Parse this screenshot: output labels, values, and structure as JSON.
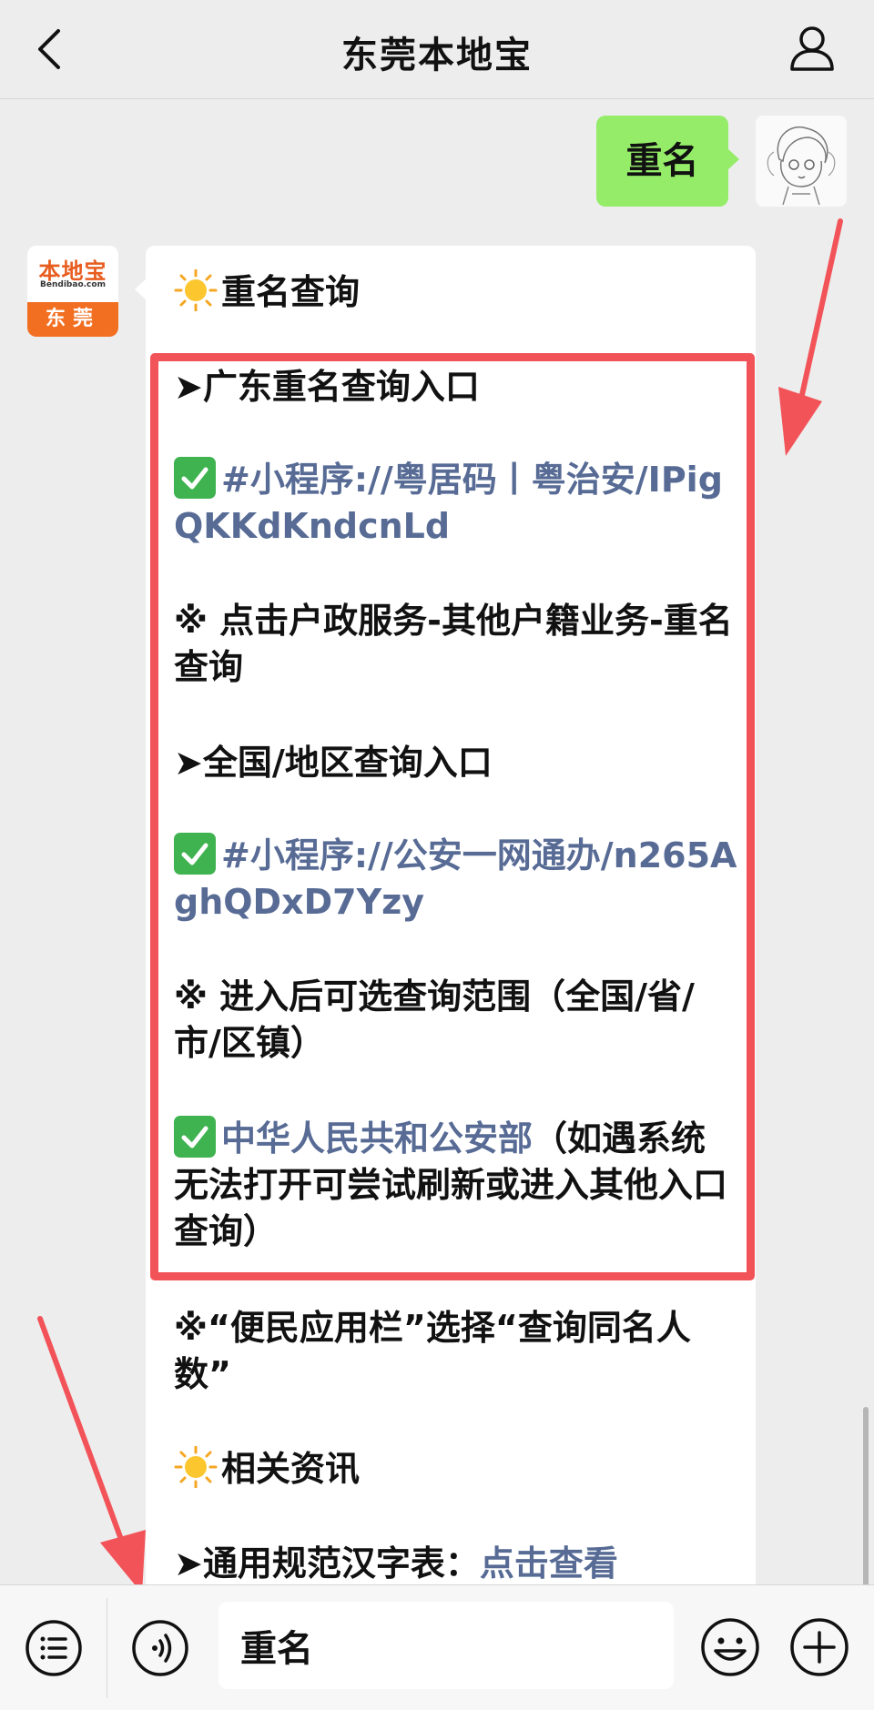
{
  "header": {
    "title": "东莞本地宝"
  },
  "sent_message": {
    "text": "重名"
  },
  "bot": {
    "logo_text": "本地宝",
    "logo_domain": "Bendibao.com",
    "logo_city": "东莞"
  },
  "message": {
    "heading": "重名查询",
    "guangdong_entry": "➤广东重名查询入口",
    "mini_program_1": "#小程序://粤居码丨粤治安/IPigQKKdKndcnLd",
    "note_1": "※ 点击户政服务-其他户籍业务-重名查询",
    "national_entry": "➤全国/地区查询入口",
    "mini_program_2": "#小程序://公安一网通办/n265AghQDxD7Yzy",
    "note_2": "※ 进入后可选查询范围（全国/省/市/区镇）",
    "ministry_link": "中华人民共和公安部",
    "ministry_note": "（如遇系统无法打开可尝试刷新或进入其他入口查询）",
    "note_3": "※“便民应用栏”选择“查询同名人数”",
    "related_heading": "相关资讯",
    "standard_chars_label": "➤通用规范汉字表：",
    "standard_chars_link": "点击查看"
  },
  "input_bar": {
    "value": "重名"
  },
  "colors": {
    "sent_bubble": "#95ec69",
    "link": "#576b95",
    "highlight": "#f25358",
    "brand_orange": "#f26f21"
  },
  "icons": [
    "chevron-left-icon",
    "person-icon",
    "sun-icon",
    "check-icon",
    "menu-list-icon",
    "voice-icon",
    "emoji-icon",
    "plus-icon"
  ]
}
